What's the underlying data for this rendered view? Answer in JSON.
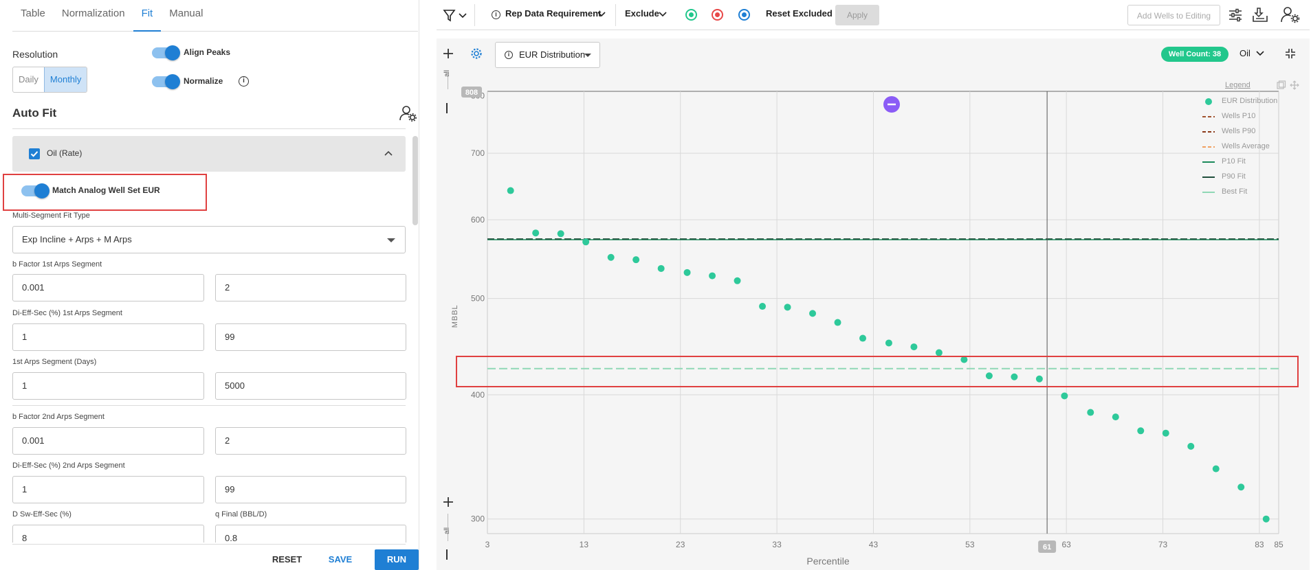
{
  "left": {
    "tabs": [
      "Table",
      "Normalization",
      "Fit",
      "Manual"
    ],
    "resolution_label": "Resolution",
    "resolution_options": [
      "Daily",
      "Monthly"
    ],
    "align_peaks_label": "Align Peaks",
    "normalize_label": "Normalize",
    "auto_fit_title": "Auto Fit",
    "phase_label": "Oil (Rate)",
    "match_label": "Match Analog Well Set EUR",
    "fit_type_label": "Multi-Segment Fit Type",
    "fit_type_value": "Exp Incline + Arps + M Arps",
    "fields": [
      {
        "label": "b Factor 1st Arps Segment",
        "min": "0.001",
        "max": "2"
      },
      {
        "label": "Di-Eff-Sec (%) 1st Arps Segment",
        "min": "1",
        "max": "99"
      },
      {
        "label": "1st Arps Segment (Days)",
        "min": "1",
        "max": "5000"
      },
      {
        "label": "b Factor 2nd Arps Segment",
        "min": "0.001",
        "max": "2"
      },
      {
        "label": "Di-Eff-Sec (%) 2nd Arps Segment",
        "min": "1",
        "max": "99"
      }
    ],
    "d_sw_label": "D Sw-Eff-Sec (%)",
    "d_sw_value": "8",
    "q_final_label": "q Final (BBL/D)",
    "q_final_value": "0.8",
    "reset": "RESET",
    "save": "SAVE",
    "run": "RUN"
  },
  "toolbar": {
    "rep_data": "Rep Data Requirement",
    "exclude": "Exclude",
    "reset_excluded": "Reset Excluded",
    "apply": "Apply",
    "add_wells": "Add Wells to Editing",
    "colors": {
      "green": "#22c78c",
      "red": "#e84848",
      "blue": "#1f7fd4"
    }
  },
  "chart_header": {
    "dropdown": "EUR Distribution",
    "well_count": "Well Count: 38",
    "phase": "Oil",
    "all_top": "all",
    "all_bottom": "all",
    "y_max_badge": "808",
    "x_cursor_badge": "61"
  },
  "legend": {
    "title": "Legend",
    "items": [
      {
        "name": "EUR Distribution",
        "style": "dot",
        "color": "#2ec99a"
      },
      {
        "name": "Wells P10",
        "style": "dash",
        "color": "#a0522d"
      },
      {
        "name": "Wells P90",
        "style": "dash",
        "color": "#8b3a1a"
      },
      {
        "name": "Wells Average",
        "style": "dash",
        "color": "#f0a060"
      },
      {
        "name": "P10 Fit",
        "style": "line",
        "color": "#1a8a5a"
      },
      {
        "name": "P90 Fit",
        "style": "line",
        "color": "#1e4d3a"
      },
      {
        "name": "Best Fit",
        "style": "line",
        "color": "#8fd8b5"
      }
    ]
  },
  "chart_data": {
    "type": "scatter",
    "xlabel": "Percentile",
    "ylabel": "MBBL",
    "xlim": [
      3,
      85
    ],
    "ylim": [
      290,
      808
    ],
    "y_scale": "log",
    "x_ticks": [
      3,
      13,
      23,
      33,
      43,
      53,
      63,
      73,
      83,
      85
    ],
    "y_ticks": [
      300,
      400,
      500,
      600,
      700,
      800
    ],
    "grid": true,
    "legend_position": "top-right",
    "cursor_x": 61,
    "series": [
      {
        "name": "EUR Distribution",
        "x": [
          5.4,
          8.0,
          10.6,
          13.2,
          15.8,
          18.4,
          21.0,
          23.7,
          26.3,
          28.9,
          31.5,
          34.1,
          36.7,
          39.3,
          41.9,
          44.6,
          47.2,
          49.8,
          52.4,
          55.0,
          57.6,
          60.2,
          62.8,
          65.5,
          68.1,
          70.7,
          73.3,
          75.9,
          78.5,
          81.1,
          83.7
        ],
        "y": [
          642,
          582,
          581,
          570,
          550,
          547,
          536,
          531,
          527,
          521,
          491,
          490,
          483,
          473,
          456,
          451,
          447,
          441,
          434,
          418,
          417,
          415,
          399,
          384,
          380,
          368,
          366,
          355,
          337,
          323,
          300
        ]
      },
      {
        "name": "P10 Fit",
        "x": [
          3,
          85
        ],
        "y": [
          573,
          573
        ]
      },
      {
        "name": "P90 Fit",
        "x": [
          3,
          85
        ],
        "y": [
          574,
          574
        ]
      },
      {
        "name": "Best Fit",
        "x": [
          3,
          85
        ],
        "y": [
          425,
          425
        ]
      }
    ]
  }
}
